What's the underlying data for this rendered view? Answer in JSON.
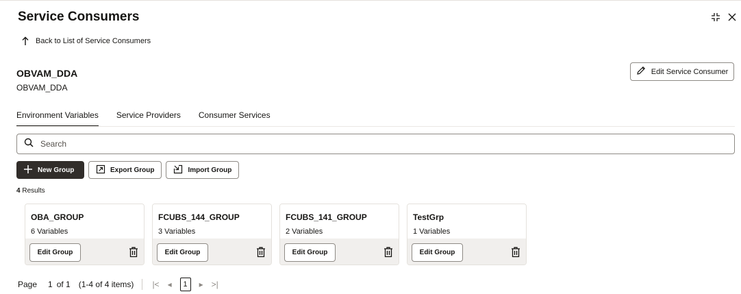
{
  "header": {
    "title": "Service Consumers"
  },
  "back": {
    "label": "Back to List of Service Consumers"
  },
  "consumer": {
    "name": "OBVAM_DDA",
    "sub": "OBVAM_DDA",
    "edit_label": "Edit Service Consumer"
  },
  "tabs": [
    {
      "label": "Environment Variables",
      "active": true
    },
    {
      "label": "Service Providers",
      "active": false
    },
    {
      "label": "Consumer Services",
      "active": false
    }
  ],
  "search": {
    "placeholder": "Search",
    "value": ""
  },
  "toolbar": {
    "new_group": "New Group",
    "export_group": "Export Group",
    "import_group": "Import Group"
  },
  "results": {
    "count": "4",
    "label": " Results"
  },
  "groups": [
    {
      "name": "OBA_GROUP",
      "variables": "6 Variables",
      "edit": "Edit Group"
    },
    {
      "name": "FCUBS_144_GROUP",
      "variables": "3 Variables",
      "edit": "Edit Group"
    },
    {
      "name": "FCUBS_141_GROUP",
      "variables": "2 Variables",
      "edit": "Edit Group"
    },
    {
      "name": "TestGrp",
      "variables": "1 Variables",
      "edit": "Edit Group"
    }
  ],
  "pagination": {
    "page_label": "Page",
    "page": "1",
    "of": "of 1",
    "range": "(1-4 of 4 items)",
    "current": "1"
  },
  "icons": {
    "collapse": "collapse-icon",
    "close": "close-icon",
    "back": "arrow-up-icon",
    "edit": "pencil-icon",
    "search": "search-icon",
    "plus": "plus-icon",
    "export": "export-icon",
    "import": "import-icon",
    "delete": "trash-icon",
    "first": "first-page-icon",
    "prev": "prev-page-icon",
    "next": "next-page-icon",
    "last": "last-page-icon"
  },
  "colors": {
    "primary_button": "#312d2a",
    "card_footer": "#f1efed",
    "border": "#8e8a85"
  }
}
